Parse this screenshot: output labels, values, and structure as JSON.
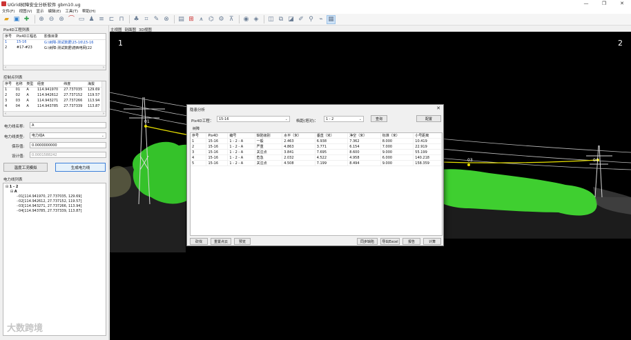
{
  "window": {
    "title": "UGrid树障安全分析软件 gbm10.ug",
    "min": "—",
    "max": "❐",
    "close": "✕"
  },
  "menu": [
    "文件(F)",
    "视图(V)",
    "显示",
    "编辑(E)",
    "工具(T)",
    "帮助(H)"
  ],
  "toolbar_icons": [
    "open-folder-icon",
    "save-icon",
    "add-icon",
    "zoom-in-icon",
    "zoom-out-icon",
    "zoom-fit-icon",
    "curve-icon",
    "view-front-icon",
    "person-icon",
    "layer-icon",
    "ruler-icon",
    "measure-icon",
    "tree-icon",
    "crop-icon",
    "export-icon",
    "settings-icon",
    "print-icon",
    "plus-box-icon",
    "tower-icon",
    "chart-icon",
    "delete-icon",
    "eye-icon",
    "layers-icon",
    "split-icon",
    "slope-icon",
    "pen-icon",
    "node-icon",
    "select-icon"
  ],
  "left": {
    "project_list_title": "Pix4D工程列表",
    "project_headers": [
      "序号",
      "Pix4D工程名",
      "影像目录"
    ],
    "projects": [
      [
        "1",
        "15-16",
        "G:\\树障-测试数据\\15-16\\15-16"
      ],
      [
        "2",
        "#17-#23",
        "G:\\树障-测试数据\\德西电网(22"
      ]
    ],
    "control_list_title": "控制点列表",
    "control_headers": [
      "序号",
      "名称",
      "类型",
      "经度",
      "纬度",
      "海拔"
    ],
    "controls": [
      [
        "1",
        "01",
        "A",
        "114.941970",
        "27.737035",
        "129.69"
      ],
      [
        "2",
        "02",
        "A",
        "114.942612",
        "27.737152",
        "119.57"
      ],
      [
        "3",
        "03",
        "A",
        "114.943271",
        "27.737266",
        "113.94"
      ],
      [
        "4",
        "04",
        "A",
        "114.943785",
        "27.737339",
        "113.87"
      ]
    ],
    "line_name_label": "电力线名称:",
    "line_name_value": "A",
    "line_type_label": "电力线类型:",
    "line_type_value": "电力线A",
    "reserve_label": "保存值:",
    "reserve_value": "0.0000000000",
    "design_label": "设计值:",
    "design_value": "0.0001588242",
    "btn_sim": "温度工况模拟",
    "btn_build": "生成电力线",
    "line_list_title": "电力线列表",
    "tree": {
      "root": "1 - 2",
      "child": "A",
      "leaves": [
        "01[114.941970, 27.737035, 129.69]",
        "02[114.942612, 27.737152, 119.57]",
        "03[114.943271, 27.737266, 113.94]",
        "04[114.943785, 27.737339, 113.87]"
      ]
    },
    "watermark": "大数跨境"
  },
  "view_tabs": [
    "主视图",
    "剖面图",
    "3D视图"
  ],
  "viewport": {
    "num_left": "1",
    "num_right": "2",
    "point_labels": [
      "01",
      "03",
      "04"
    ]
  },
  "dialog": {
    "title": "隐患分析",
    "close": "✕",
    "project_label": "Pix4D工程：",
    "project_value": "15-16",
    "section_label": "档距(塔对)：",
    "section_value": "1 - 2",
    "query_btn": "查询",
    "config_btn": "配置",
    "tab": "树障",
    "headers": [
      "序号",
      "Pix4D",
      "编号",
      "缺陷级别",
      "水平（米）",
      "垂直（米）",
      "净空（米）",
      "标准（米）",
      "小号距离"
    ],
    "rows": [
      [
        "1",
        "15-16",
        "1 - 2 - A",
        "一般",
        "2.463",
        "6.938",
        "7.362",
        "8.000",
        "10.419"
      ],
      [
        "2",
        "15-16",
        "1 - 2 - A",
        "严重",
        "4.863",
        "3.771",
        "6.154",
        "7.000",
        "22.919"
      ],
      [
        "3",
        "15-16",
        "1 - 2 - A",
        "关注点",
        "3.841",
        "7.695",
        "8.600",
        "9.000",
        "55.199"
      ],
      [
        "4",
        "15-16",
        "1 - 2 - A",
        "危急",
        "2.032",
        "4.522",
        "4.958",
        "6.000",
        "140.218"
      ],
      [
        "5",
        "15-16",
        "1 - 2 - A",
        "关注点",
        "4.508",
        "7.199",
        "8.494",
        "9.000",
        "158.359"
      ]
    ],
    "btn_fell": "砍伐",
    "btn_rebuild": "重置点云",
    "btn_preview": "预览",
    "btn_sync": "同步缺陷",
    "btn_export": "导出Excel",
    "btn_report": "报告",
    "btn_calc": "计算"
  },
  "colors": {
    "accent": "#3c7fd9",
    "viewport_bg": "#000000",
    "wire": "#e8e000",
    "vegetation": "#35c22a"
  }
}
